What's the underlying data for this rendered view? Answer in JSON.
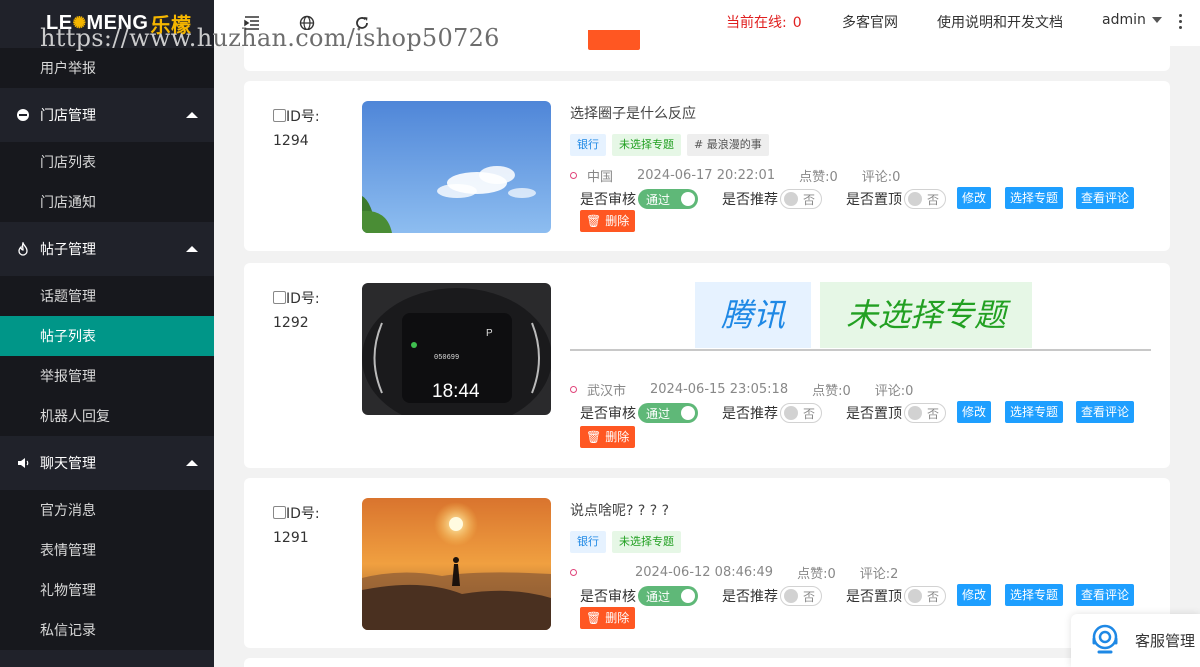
{
  "app": {
    "logo_main": "LE",
    "logo_o": "✺",
    "logo_rest": "MENG",
    "logo_cn": "乐檬"
  },
  "watermark": "https://www.huzhan.com/ishop50726",
  "sidebar": {
    "items": [
      {
        "type": "sub",
        "label": "用户举报"
      },
      {
        "type": "group",
        "label": "门店管理",
        "icon": "circle-icon"
      },
      {
        "type": "sub",
        "label": "门店列表"
      },
      {
        "type": "sub",
        "label": "门店通知"
      },
      {
        "type": "group",
        "label": "帖子管理",
        "icon": "fire-icon"
      },
      {
        "type": "sub",
        "label": "话题管理"
      },
      {
        "type": "sub",
        "label": "帖子列表",
        "active": true
      },
      {
        "type": "sub",
        "label": "举报管理"
      },
      {
        "type": "sub",
        "label": "机器人回复"
      },
      {
        "type": "group",
        "label": "聊天管理",
        "icon": "speaker-icon"
      },
      {
        "type": "sub",
        "label": "官方消息"
      },
      {
        "type": "sub",
        "label": "表情管理"
      },
      {
        "type": "sub",
        "label": "礼物管理"
      },
      {
        "type": "sub",
        "label": "私信记录"
      }
    ]
  },
  "header": {
    "online_label": "当前在线:",
    "online_count": "0",
    "link_site": "多客官网",
    "link_docs": "使用说明和开发文档",
    "user": "admin"
  },
  "posts": [
    {
      "id_label": "ID号:",
      "id": "1294",
      "title": "选择圈子是什么反应",
      "tags": [
        {
          "text": "银行",
          "color": "blue"
        },
        {
          "text": "未选择专题",
          "color": "green"
        },
        {
          "text": "# 最浪漫的事",
          "color": "gray"
        }
      ],
      "location": "中国",
      "time": "2024-06-17 20:22:01",
      "likes": "点赞:0",
      "comments": "评论:0",
      "image": "sky"
    },
    {
      "id_label": "ID号:",
      "id": "1292",
      "title": "",
      "big_tags": [
        {
          "text": "腾讯",
          "color": "blue"
        },
        {
          "text": "未选择专题",
          "color": "green"
        }
      ],
      "location": "武汉市",
      "time": "2024-06-15 23:05:18",
      "likes": "点赞:0",
      "comments": "评论:0",
      "image": "dashboard",
      "dash_time": "18:44",
      "dash_odo": "050699",
      "dash_gear": "P"
    },
    {
      "id_label": "ID号:",
      "id": "1291",
      "title": "说点啥呢? ? ? ?",
      "tags": [
        {
          "text": "银行",
          "color": "blue"
        },
        {
          "text": "未选择专题",
          "color": "green"
        }
      ],
      "location": "",
      "time": "2024-06-12 08:46:49",
      "likes": "点赞:0",
      "comments": "评论:2",
      "image": "sunset"
    }
  ],
  "controls": {
    "audit_label": "是否审核",
    "audit_value": "通过",
    "recommend_label": "是否推荐",
    "recommend_value": "否",
    "top_label": "是否置顶",
    "top_value": "否",
    "edit": "修改",
    "choose_topic": "选择专题",
    "view_comments": "查看评论",
    "delete": "删除"
  },
  "kefu": {
    "label": "客服管理"
  },
  "colors": {
    "accent": "#009688",
    "primary_btn": "#1e9fff",
    "danger": "#ff5722",
    "switch_on": "#5fb878",
    "sidebar": "#20222a"
  }
}
